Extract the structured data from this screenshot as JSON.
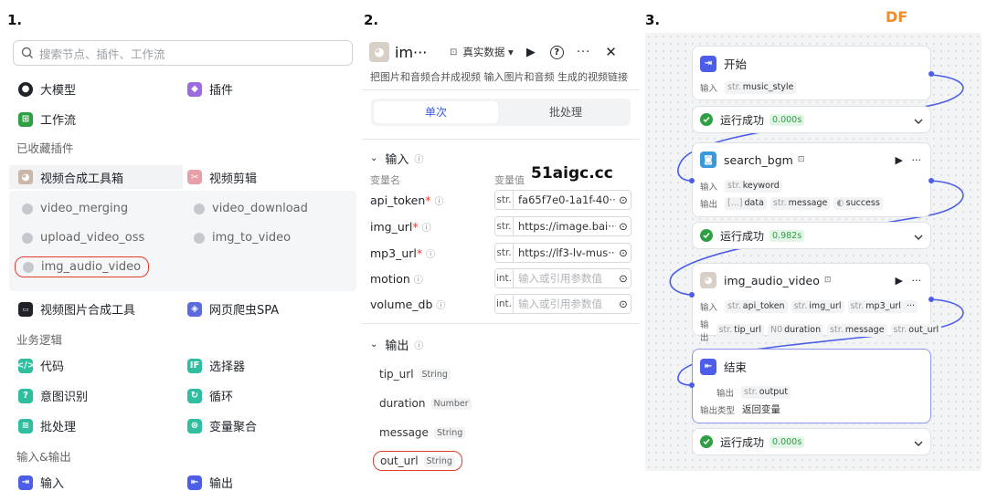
{
  "steps": {
    "s1": "1.",
    "s2": "2.",
    "s3": "3."
  },
  "watermark": "DF",
  "panel1": {
    "search_placeholder": "搜索节点、插件、工作流",
    "top": [
      {
        "label": "大模型"
      },
      {
        "label": "插件"
      },
      {
        "label": "工作流"
      }
    ],
    "fav_title": "已收藏插件",
    "fav": [
      {
        "label": "视频合成工具箱"
      },
      {
        "label": "视频剪辑"
      }
    ],
    "tools": [
      "video_merging",
      "video_download",
      "upload_video_oss",
      "img_to_video",
      "img_audio_video"
    ],
    "more": [
      {
        "label": "视频图片合成工具"
      },
      {
        "label": "网页爬虫SPA"
      }
    ],
    "biz_title": "业务逻辑",
    "biz": [
      {
        "label": "代码"
      },
      {
        "label": "选择器"
      },
      {
        "label": "意图识别"
      },
      {
        "label": "循环"
      },
      {
        "label": "批处理"
      },
      {
        "label": "变量聚合"
      }
    ],
    "io_title": "输入&输出",
    "io": [
      {
        "label": "输入"
      },
      {
        "label": "输出"
      }
    ]
  },
  "panel2": {
    "title": "im···",
    "mode": "真实数据",
    "desc": "把图片和音频合并成视频 输入图片和音频 生成的视频链接",
    "tab_single": "单次",
    "tab_batch": "批处理",
    "input_title": "输入",
    "col_name": "变量名",
    "col_value": "变量值",
    "watermark": "51aigc.cc",
    "inputs": [
      {
        "name": "api_token",
        "type": "str.",
        "value": "fa65f7e0-1a1f-40···",
        "req": "*"
      },
      {
        "name": "img_url",
        "type": "str.",
        "value": "https://image.bai···",
        "req": "*"
      },
      {
        "name": "mp3_url",
        "type": "str.",
        "value": "https://lf3-lv-mus···",
        "req": "*"
      },
      {
        "name": "motion",
        "type": "int.",
        "value": "输入或引用参数值",
        "req": ""
      },
      {
        "name": "volume_db",
        "type": "int.",
        "value": "输入或引用参数值",
        "req": ""
      }
    ],
    "output_title": "输出",
    "outputs": [
      {
        "name": "tip_url",
        "type": "String"
      },
      {
        "name": "duration",
        "type": "Number"
      },
      {
        "name": "message",
        "type": "String"
      },
      {
        "name": "out_url",
        "type": "String"
      }
    ]
  },
  "panel3": {
    "start": {
      "title": "开始",
      "in_label": "输入",
      "param_type": "str.",
      "param": "music_style"
    },
    "ok1": {
      "text": "运行成功",
      "time": "0.000s"
    },
    "bgm": {
      "title": "search_bgm",
      "in_label": "输入",
      "in_type": "str.",
      "in_param": "keyword",
      "out_label": "输出",
      "outs": [
        {
          "type": "[...]",
          "name": "data"
        },
        {
          "type": "str.",
          "name": "message"
        },
        {
          "type": "◐",
          "name": "success"
        }
      ]
    },
    "ok2": {
      "text": "运行成功",
      "time": "0.982s"
    },
    "iav": {
      "title": "img_audio_video",
      "in_label": "输入",
      "ins": [
        {
          "type": "str.",
          "name": "api_token"
        },
        {
          "type": "str.",
          "name": "img_url"
        },
        {
          "type": "str.",
          "name": "mp3_url"
        }
      ],
      "out_label": "输出",
      "outs": [
        {
          "type": "str.",
          "name": "tip_url"
        },
        {
          "type": "N0",
          "name": "duration"
        },
        {
          "type": "str.",
          "name": "message"
        },
        {
          "type": "str.",
          "name": "out_url"
        }
      ]
    },
    "end": {
      "title": "结束",
      "out_label": "输出",
      "out_type": "str.",
      "out_param": "output",
      "rtype_label": "输出类型",
      "rtype": "返回变量"
    },
    "ok3": {
      "text": "运行成功",
      "time": "0.000s"
    }
  },
  "colors": {
    "accent": "#4c5ee8",
    "success": "#2ea043",
    "highlight": "#e03e2d"
  }
}
